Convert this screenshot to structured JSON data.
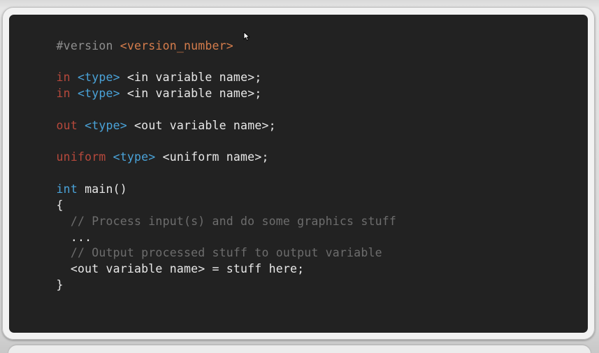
{
  "slide": {
    "code": {
      "version_directive": "#version",
      "version_placeholder": "<version_number>",
      "in1_kw": "in",
      "in1_type": "<type>",
      "in1_name": "<in variable name>;",
      "in2_kw": "in",
      "in2_type": "<type>",
      "in2_name": "<in variable name>;",
      "out_kw": "out",
      "out_type": "<type>",
      "out_name": "<out variable name>;",
      "uniform_kw": "uniform",
      "uniform_type": "<type>",
      "uniform_name": "<uniform name>;",
      "main_type": "int",
      "main_sig": "main()",
      "open_brace": "{",
      "comment1": "// Process input(s) and do some graphics stuff",
      "ellipsis": "...",
      "comment2": "// Output processed stuff to output variable",
      "assignment": "<out variable name> = stuff here;",
      "close_brace": "}"
    }
  },
  "colors": {
    "panel_bg": "#222222",
    "keyword_red": "#b7493c",
    "type_blue": "#4aa3d9",
    "placeholder_orange": "#d67d4c",
    "comment_gray": "#6d6d6d",
    "text": "#e8e8e8"
  },
  "icons": {
    "cursor": "mouse-pointer-icon"
  }
}
